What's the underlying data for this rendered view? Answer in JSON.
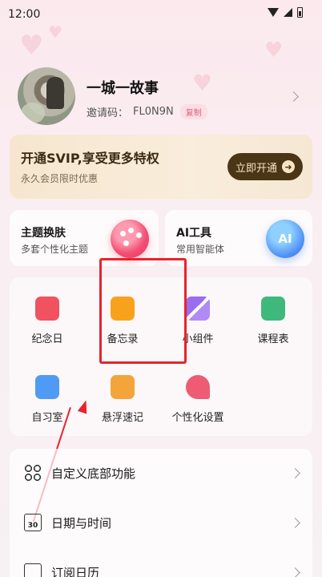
{
  "status_bar": {
    "time": "12:00"
  },
  "profile": {
    "username": "一城一故事",
    "invite_label": "邀请码：",
    "invite_code": "FL0N9N",
    "copy_label": "复制"
  },
  "vip": {
    "title": "开通SVIP,享受更多特权",
    "subtitle": "永久会员限时优惠",
    "button_label": "立即开通",
    "button_arrow": "➜"
  },
  "features": [
    {
      "title": "主题换肤",
      "subtitle": "多套个性化主题"
    },
    {
      "title": "AI工具",
      "subtitle": "常用智能体",
      "icon_text": "AI"
    }
  ],
  "grid": [
    {
      "label": "纪念日",
      "icon": "calendar-heart-icon",
      "color": "#f0525f"
    },
    {
      "label": "备忘录",
      "icon": "memo-bookmark-icon",
      "color": "#f8a21c"
    },
    {
      "label": "小组件",
      "icon": "widgets-icon",
      "color": "#9a6cf0"
    },
    {
      "label": "课程表",
      "icon": "course-book-icon",
      "color": "#3fb97b"
    },
    {
      "label": "自习室",
      "icon": "study-room-icon",
      "color": "#4f9af5"
    },
    {
      "label": "悬浮速记",
      "icon": "floating-note-icon",
      "color": "#f3a53b"
    },
    {
      "label": "个性化设置",
      "icon": "personalize-star-icon",
      "color": "#ee5b74"
    }
  ],
  "list": [
    {
      "label": "自定义底部功能",
      "icon": "grid-circles-icon"
    },
    {
      "label": "日期与时间",
      "icon": "calendar-30-icon",
      "icon_text": "30"
    },
    {
      "label": "订阅日历",
      "icon": "subscribe-calendar-icon"
    }
  ],
  "colors": {
    "accent": "#e0607d",
    "highlight": "#e8232d",
    "vip_button": "#4a3515"
  }
}
